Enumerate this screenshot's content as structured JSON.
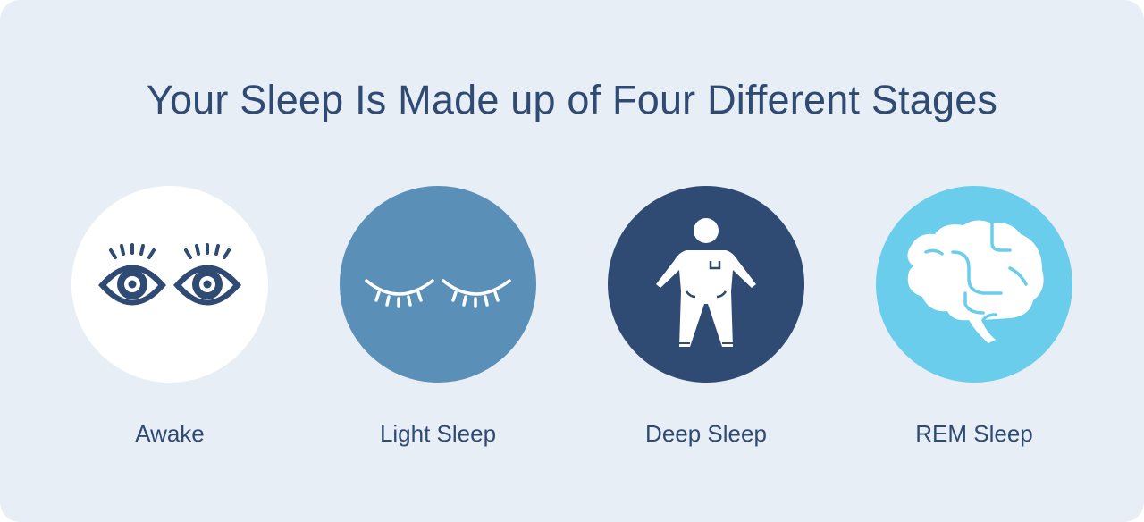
{
  "title": "Your Sleep Is Made up of Four Different Stages",
  "colors": {
    "background": "#e8eef5",
    "text": "#2f4a73",
    "awake": "#ffffff",
    "light_sleep": "#5a8fb8",
    "deep_sleep": "#2f4a73",
    "rem_sleep": "#6bcdec"
  },
  "stages": [
    {
      "label": "Awake",
      "icon": "open-eyes-icon",
      "color": "#ffffff"
    },
    {
      "label": "Light Sleep",
      "icon": "closed-eyes-icon",
      "color": "#5a8fb8"
    },
    {
      "label": "Deep Sleep",
      "icon": "sleeping-person-icon",
      "color": "#2f4a73"
    },
    {
      "label": "REM Sleep",
      "icon": "brain-icon",
      "color": "#6bcdec"
    }
  ]
}
